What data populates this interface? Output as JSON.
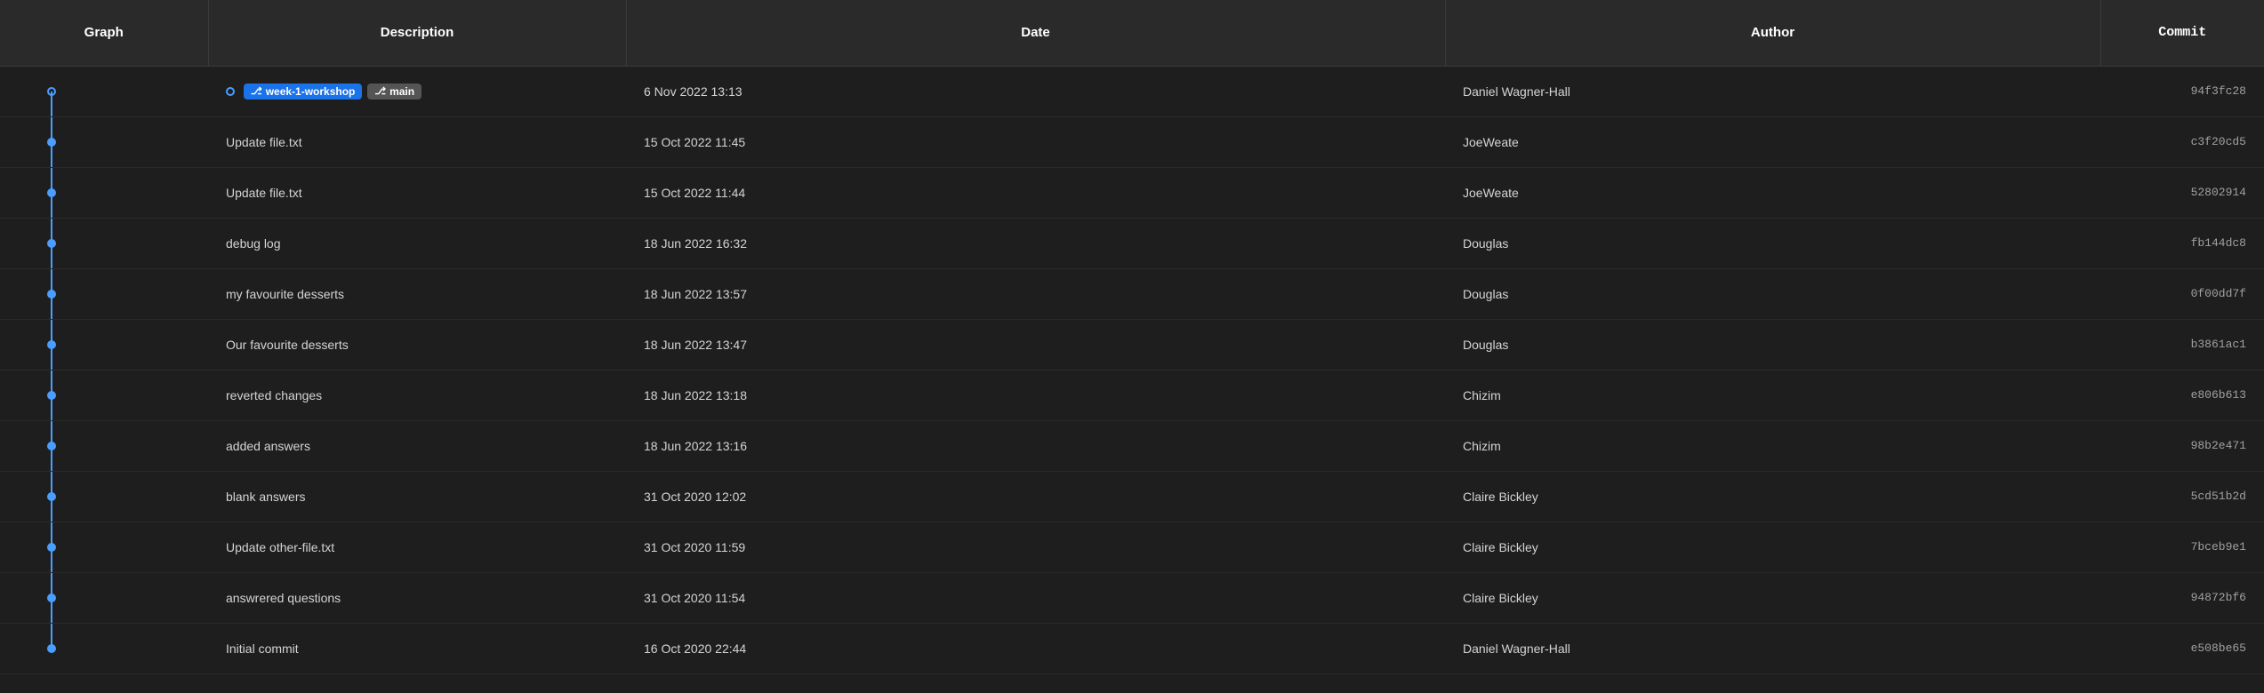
{
  "header": {
    "col_graph": "Graph",
    "col_description": "Description",
    "col_date": "Date",
    "col_author": "Author",
    "col_commit": "Commit"
  },
  "rows": [
    {
      "id": 1,
      "graph_type": "hollow_dot",
      "has_branch_tags": true,
      "branch_tag_1": "week-1-workshop",
      "branch_tag_2": "main",
      "description": "",
      "date": "6 Nov 2022 13:13",
      "author": "Daniel Wagner-Hall",
      "commit": "94f3fc28",
      "is_first": true,
      "is_last": false
    },
    {
      "id": 2,
      "graph_type": "dot",
      "has_branch_tags": false,
      "description": "Update file.txt",
      "date": "15 Oct 2022 11:45",
      "author": "JoeWeate",
      "commit": "c3f20cd5",
      "is_first": false,
      "is_last": false
    },
    {
      "id": 3,
      "graph_type": "dot",
      "has_branch_tags": false,
      "description": "Update file.txt",
      "date": "15 Oct 2022 11:44",
      "author": "JoeWeate",
      "commit": "52802914",
      "is_first": false,
      "is_last": false
    },
    {
      "id": 4,
      "graph_type": "dot",
      "has_branch_tags": false,
      "description": "debug log",
      "date": "18 Jun 2022 16:32",
      "author": "Douglas",
      "commit": "fb144dc8",
      "is_first": false,
      "is_last": false
    },
    {
      "id": 5,
      "graph_type": "dot",
      "has_branch_tags": false,
      "description": "my favourite desserts",
      "date": "18 Jun 2022 13:57",
      "author": "Douglas",
      "commit": "0f00dd7f",
      "is_first": false,
      "is_last": false
    },
    {
      "id": 6,
      "graph_type": "dot",
      "has_branch_tags": false,
      "description": "Our favourite desserts",
      "date": "18 Jun 2022 13:47",
      "author": "Douglas",
      "commit": "b3861ac1",
      "is_first": false,
      "is_last": false
    },
    {
      "id": 7,
      "graph_type": "dot",
      "has_branch_tags": false,
      "description": "reverted changes",
      "date": "18 Jun 2022 13:18",
      "author": "Chizim",
      "commit": "e806b613",
      "is_first": false,
      "is_last": false
    },
    {
      "id": 8,
      "graph_type": "dot",
      "has_branch_tags": false,
      "description": "added answers",
      "date": "18 Jun 2022 13:16",
      "author": "Chizim",
      "commit": "98b2e471",
      "is_first": false,
      "is_last": false
    },
    {
      "id": 9,
      "graph_type": "dot",
      "has_branch_tags": false,
      "description": "blank answers",
      "date": "31 Oct 2020 12:02",
      "author": "Claire Bickley",
      "commit": "5cd51b2d",
      "is_first": false,
      "is_last": false
    },
    {
      "id": 10,
      "graph_type": "dot",
      "has_branch_tags": false,
      "description": "Update other-file.txt",
      "date": "31 Oct 2020 11:59",
      "author": "Claire Bickley",
      "commit": "7bceb9e1",
      "is_first": false,
      "is_last": false
    },
    {
      "id": 11,
      "graph_type": "dot",
      "has_branch_tags": false,
      "description": "answrered questions",
      "date": "31 Oct 2020 11:54",
      "author": "Claire Bickley",
      "commit": "94872bf6",
      "is_first": false,
      "is_last": false
    },
    {
      "id": 12,
      "graph_type": "dot",
      "has_branch_tags": false,
      "description": "Initial commit",
      "date": "16 Oct 2020 22:44",
      "author": "Daniel Wagner-Hall",
      "commit": "e508be65",
      "is_first": false,
      "is_last": true
    }
  ]
}
